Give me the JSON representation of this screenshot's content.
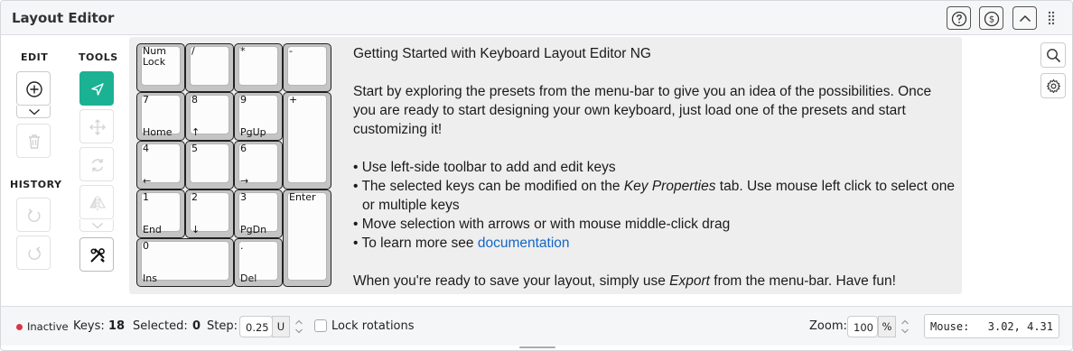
{
  "header": {
    "title": "Layout Editor",
    "buttons": [
      {
        "icon": "help-icon",
        "label": "?"
      },
      {
        "icon": "dollar-icon",
        "label": "$"
      },
      {
        "icon": "chevron-up-icon"
      },
      {
        "icon": "drag-handle-icon"
      }
    ]
  },
  "toolbar": {
    "edit_label": "EDIT",
    "tools_label": "TOOLS",
    "history_label": "HISTORY",
    "edit_buttons": [
      "add-key-icon",
      "dropdown-chevron-icon",
      "trash-icon"
    ],
    "tool_buttons": [
      "select-pointer-icon",
      "move-icon",
      "rotate-icon",
      "mirror-icon",
      "chevron-down-icon",
      "tools-icon"
    ],
    "history_buttons": [
      "undo-icon",
      "redo-icon"
    ],
    "accent_color": "#1bb193"
  },
  "keys": [
    {
      "top": "Num\nLock",
      "bottom": ""
    },
    {
      "top": "/",
      "bottom": ""
    },
    {
      "top": "*",
      "bottom": ""
    },
    {
      "top": "-",
      "bottom": ""
    },
    {
      "top": "7",
      "bottom": "Home"
    },
    {
      "top": "8",
      "bottom": "↑"
    },
    {
      "top": "9",
      "bottom": "PgUp"
    },
    {
      "top": "+",
      "bottom": ""
    },
    {
      "top": "4",
      "bottom": "←"
    },
    {
      "top": "5",
      "bottom": ""
    },
    {
      "top": "6",
      "bottom": "→"
    },
    {
      "top": "1",
      "bottom": "End"
    },
    {
      "top": "2",
      "bottom": "↓"
    },
    {
      "top": "3",
      "bottom": "PgDn"
    },
    {
      "top": "Enter",
      "bottom": ""
    },
    {
      "top": "0",
      "bottom": "Ins"
    },
    {
      "top": ".",
      "bottom": "Del"
    }
  ],
  "help": {
    "heading": "Getting Started with Keyboard Layout Editor NG",
    "intro": "Start by exploring the presets from the menu-bar to give you an idea of the possibilities. Once you are ready to start designing your own keyboard, just load one of the presets and start customizing it!",
    "bullet1": "• Use left-side toolbar to add and edit keys",
    "bullet2_pre": "• The selected keys can be modified on the ",
    "bullet2_em": "Key Properties",
    "bullet2_post": " tab. Use mouse left click to select one or multiple keys",
    "bullet3": "• Move selection with arrows or with mouse middle-click drag",
    "bullet4_pre": "• To learn more see ",
    "bullet4_link": "documentation",
    "outro_pre": "When you're ready to save your layout, simply use ",
    "outro_em": "Export",
    "outro_post": " from the menu-bar. Have fun!"
  },
  "side_buttons": [
    "search-icon",
    "settings-icon"
  ],
  "status": {
    "state": "Inactive",
    "state_color": "#dc3545",
    "keys_label": "Keys:",
    "keys_value": "18",
    "selected_label": "Selected:",
    "selected_value": "0",
    "step_label": "Step:",
    "step_value": "0.25",
    "step_unit": "U",
    "lock_label": "Lock rotations",
    "zoom_label": "Zoom:",
    "zoom_value": "100",
    "zoom_unit": "%",
    "mouse_label": "Mouse:",
    "mouse_value": "3.02, 4.31"
  }
}
